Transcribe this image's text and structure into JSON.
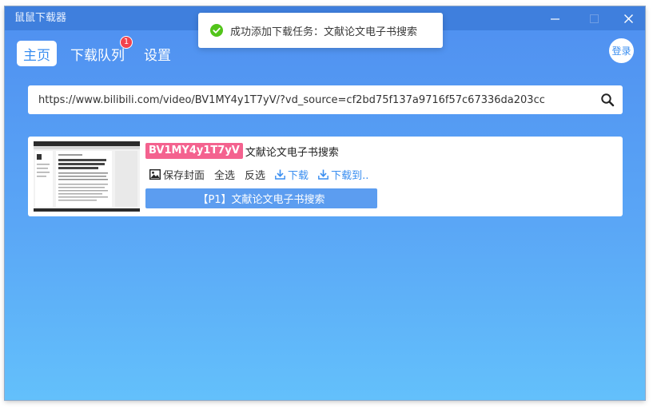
{
  "app": {
    "title": "鼠鼠下载器"
  },
  "toast": {
    "message": "成功添加下载任务：文献论文电子书搜索"
  },
  "nav": {
    "home": "主页",
    "queue": "下载队列",
    "queue_badge": "1",
    "settings": "设置",
    "login": "登录"
  },
  "search": {
    "url": "https://www.bilibili.com/video/BV1MY4y1T7yV/?vd_source=cf2bd75f137a9716f57c67336da203cc"
  },
  "video": {
    "bvid": "BV1MY4y1T7yV",
    "title": "文献论文电子书搜索",
    "actions": {
      "save_cover": "保存封面",
      "select_all": "全选",
      "invert": "反选",
      "download": "下载",
      "download_to": "下载到.."
    },
    "parts": [
      {
        "label": "【P1】文献论文电子书搜索"
      }
    ]
  },
  "colors": {
    "accent": "#3a8ef0",
    "bvid_badge": "#f4628f",
    "part_button": "#5c9df0",
    "titlebar": "#3f7fdd"
  },
  "icons": [
    "minimize-icon",
    "maximize-icon",
    "close-icon",
    "check-circle-icon",
    "search-icon",
    "image-icon",
    "download-icon"
  ]
}
